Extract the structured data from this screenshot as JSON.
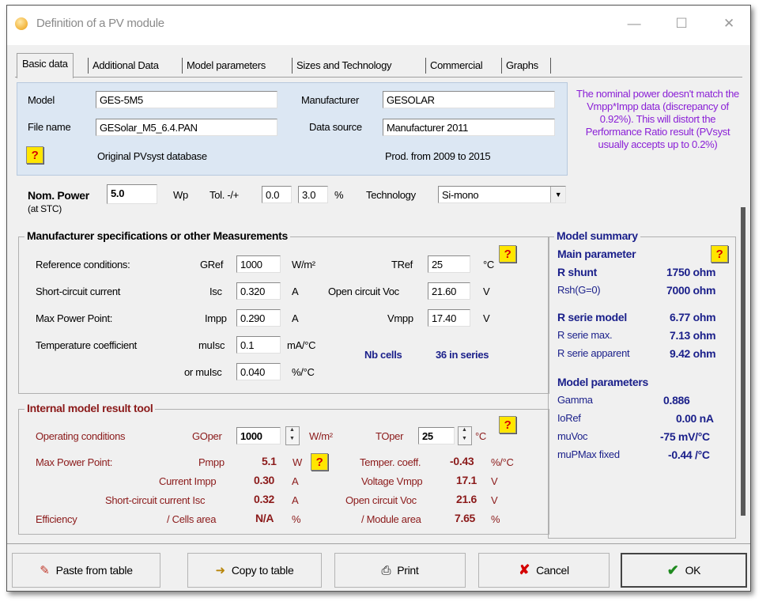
{
  "window": {
    "title": "Definition of a PV module"
  },
  "tabs": [
    "Basic data",
    "Additional Data",
    "Model parameters",
    "Sizes and Technology",
    "Commercial",
    "Graphs"
  ],
  "ids": {
    "model_label": "Model",
    "model_value": "GES-5M5",
    "manufacturer_label": "Manufacturer",
    "manufacturer_value": "GESOLAR",
    "filename_label": "File name",
    "filename_value": "GESolar_M5_6.4.PAN",
    "datasource_label": "Data source",
    "datasource_value": "Manufacturer 2011",
    "database_text": "Original PVsyst database",
    "prod_text": "Prod. from 2009 to 2015"
  },
  "warning": "The nominal power doesn't match the Vmpp*Impp data (discrepancy of 0.92%). This will distort the Performance Ratio result (PVsyst usually accepts up to 0.2%)",
  "nominal": {
    "power_label": "Nom. Power",
    "power_value": "5.0",
    "power_unit": "Wp",
    "stc": "(at STC)",
    "tol_label": "Tol. -/+",
    "tol_minus": "0.0",
    "tol_plus": "3.0",
    "tol_unit": "%",
    "tech_label": "Technology",
    "tech_value": "Si-mono"
  },
  "spec": {
    "title": "Manufacturer specifications  or  other Measurements",
    "refcond_label": "Reference conditions:",
    "gref_label": "GRef",
    "gref_value": "1000",
    "gref_unit": "W/m²",
    "tref_label": "TRef",
    "tref_value": "25",
    "tref_unit": "°C",
    "isc_desc": "Short-circuit current",
    "isc_label": "Isc",
    "isc_value": "0.320",
    "isc_unit": "A",
    "voc_label": "Open circuit Voc",
    "voc_value": "21.60",
    "voc_unit": "V",
    "mpp_desc": "Max Power Point:",
    "impp_label": "Impp",
    "impp_value": "0.290",
    "impp_unit": "A",
    "vmpp_label": "Vmpp",
    "vmpp_value": "17.40",
    "vmpp_unit": "V",
    "temp_desc": "Temperature coefficient",
    "muisc_label": "muIsc",
    "muisc_value": "0.1",
    "muisc_unit": "mA/°C",
    "muisc2_label": "or muIsc",
    "muisc2_value": "0.040",
    "muisc2_unit": "%/°C",
    "cells_label": "Nb cells",
    "cells_value": "36 in series"
  },
  "tool": {
    "title": "Internal model result tool",
    "op_label": "Operating conditions",
    "goper_label": "GOper",
    "goper_value": "1000",
    "goper_unit": "W/m²",
    "toper_label": "TOper",
    "toper_value": "25",
    "toper_unit": "°C",
    "mpp_label": "Max Power Point:",
    "pmpp_label": "Pmpp",
    "pmpp_value": "5.1",
    "pmpp_unit": "W",
    "tempcoef_label": "Temper. coeff.",
    "tempcoef_value": "-0.43",
    "tempcoef_unit": "%/°C",
    "impp_label": "Current Impp",
    "impp_value": "0.30",
    "impp_unit": "A",
    "vmpp_label": "Voltage Vmpp",
    "vmpp_value": "17.1",
    "vmpp_unit": "V",
    "isc_label": "Short-circuit current Isc",
    "isc_value": "0.32",
    "isc_unit": "A",
    "voc_label": "Open circuit Voc",
    "voc_value": "21.6",
    "voc_unit": "V",
    "eff_label": "Efficiency",
    "cells_area_label": "/ Cells area",
    "cells_area_value": "N/A",
    "cells_area_unit": "%",
    "module_area_label": "/ Module area",
    "module_area_value": "7.65",
    "module_area_unit": "%"
  },
  "summary": {
    "title": "Model summary",
    "main_param": "Main parameter",
    "rshunt_label": "R shunt",
    "rshunt_value": "1750 ohm",
    "rsh0_label": "Rsh(G=0)",
    "rsh0_value": "7000 ohm",
    "rserie_label": "R serie model",
    "rserie_value": "6.77 ohm",
    "rseriemax_label": "R serie max.",
    "rseriemax_value": "7.13 ohm",
    "rserieapp_label": "R serie apparent",
    "rserieapp_value": "9.42 ohm",
    "params_title": "Model parameters",
    "gamma_label": "Gamma",
    "gamma_value": "0.886",
    "ioref_label": "IoRef",
    "ioref_value": "0.00 nA",
    "muvoc_label": "muVoc",
    "muvoc_value": "-75 mV/°C",
    "mupmax_label": "muPMax fixed",
    "mupmax_value": "-0.44 /°C"
  },
  "buttons": {
    "paste": "Paste from table",
    "copy": "Copy to table",
    "print": "Print",
    "cancel": "Cancel",
    "ok": "OK"
  },
  "colors": {
    "accent_purple": "#8a1fd6",
    "dark_red": "#8b1a1a",
    "navy": "#1a1f8a",
    "panel_blue": "#dce7f3"
  }
}
